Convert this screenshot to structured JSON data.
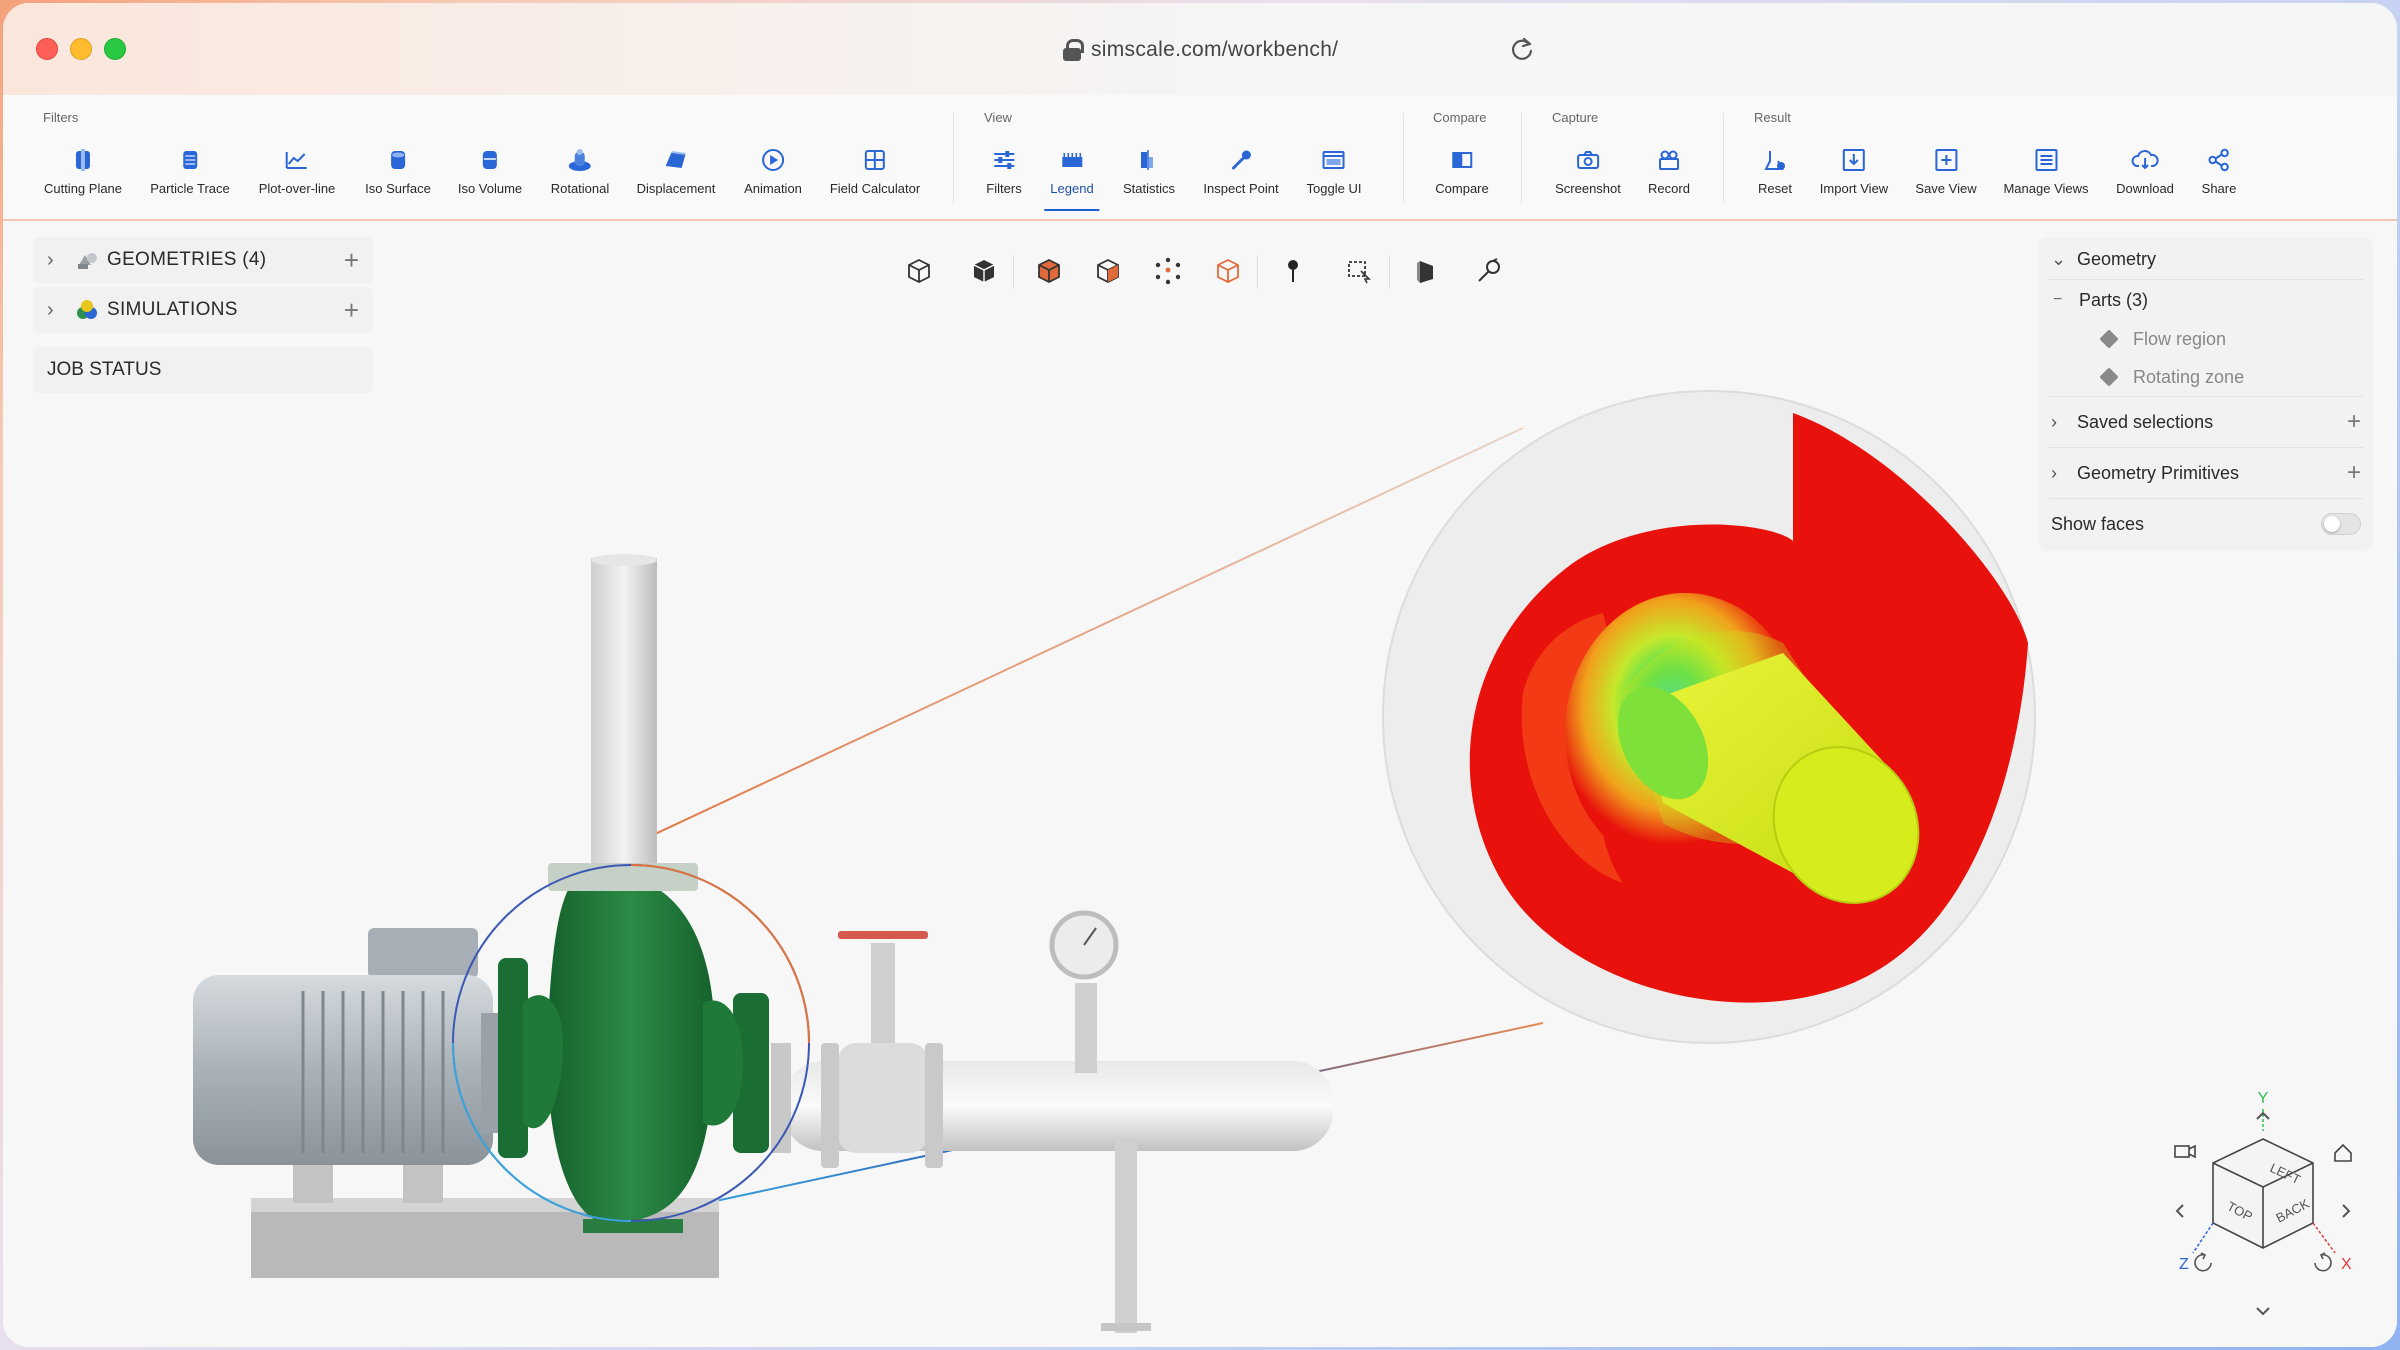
{
  "browser": {
    "url": "simscale.com/workbench/"
  },
  "toolbar": {
    "groups": {
      "filters": "Filters",
      "view": "View",
      "compare": "Compare",
      "capture": "Capture",
      "result": "Result"
    },
    "tools": {
      "cutting_plane": "Cutting Plane",
      "particle_trace": "Particle Trace",
      "plot_over_line": "Plot-over-line",
      "iso_surface": "Iso Surface",
      "iso_volume": "Iso Volume",
      "rotational": "Rotational",
      "displacement": "Displacement",
      "animation": "Animation",
      "field_calculator": "Field Calculator",
      "filters": "Filters",
      "legend": "Legend",
      "statistics": "Statistics",
      "inspect_point": "Inspect Point",
      "toggle_ui": "Toggle UI",
      "compare": "Compare",
      "screenshot": "Screenshot",
      "record": "Record",
      "reset": "Reset",
      "import_view": "Import View",
      "save_view": "Save View",
      "manage_views": "Manage Views",
      "download": "Download",
      "share": "Share"
    }
  },
  "left_panel": {
    "geometries": "GEOMETRIES (4)",
    "simulations": "SIMULATIONS",
    "job_status": "JOB STATUS"
  },
  "right_panel": {
    "geometry": "Geometry",
    "parts": "Parts (3)",
    "part_items": [
      "Flow region",
      "Rotating zone"
    ],
    "saved_selections": "Saved selections",
    "geometry_primitives": "Geometry Primitives",
    "show_faces": "Show faces"
  },
  "navcube": {
    "faces": [
      "LEFT",
      "TOP",
      "BACK"
    ],
    "axes": [
      "Y",
      "Z",
      "X"
    ]
  },
  "colors": {
    "accent": "#1e5fd0",
    "icon_blue": "#2a66d6",
    "pump_green": "#1f7a3a",
    "sim_red": "#e8110c",
    "sim_yellow": "#d9ee18"
  }
}
